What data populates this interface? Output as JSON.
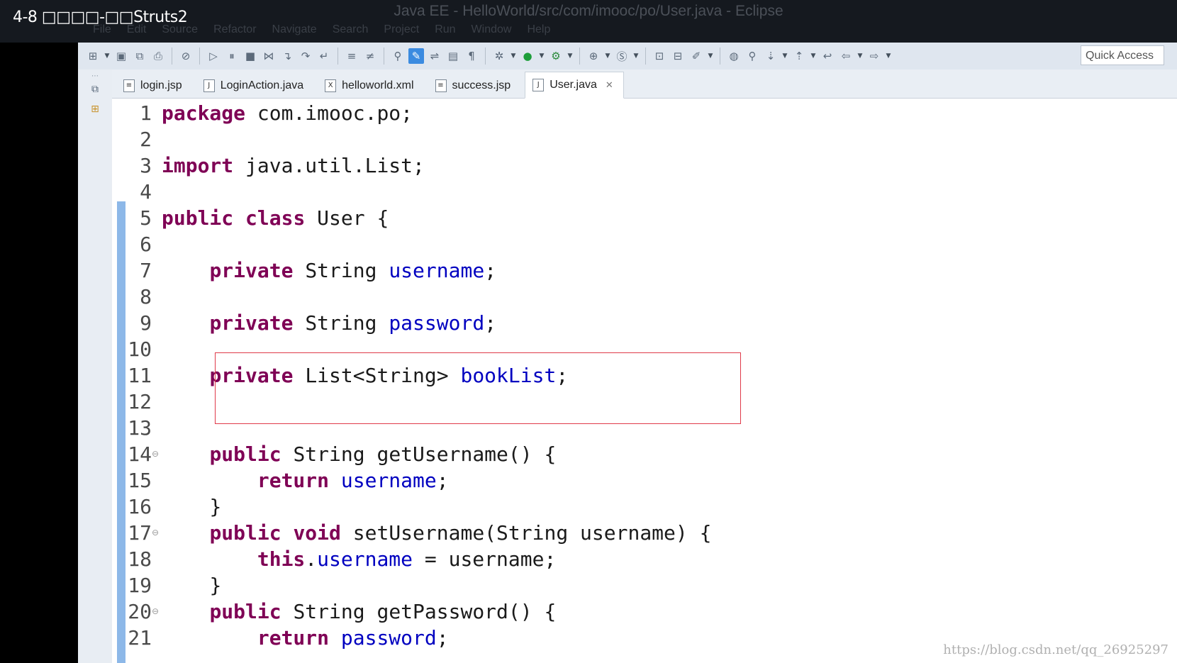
{
  "video_title": "4-8 □□□□-□□Struts2",
  "window": {
    "title": "Java EE - HelloWorld/src/com/imooc/po/User.java - Eclipse",
    "menus": [
      "File",
      "Edit",
      "Source",
      "Refactor",
      "Navigate",
      "Search",
      "Project",
      "Run",
      "Window",
      "Help"
    ]
  },
  "toolbar": {
    "quick_access": "Quick Access"
  },
  "tabs": [
    {
      "label": "login.jsp",
      "icon": "jsp-file-icon",
      "glyph": "≡"
    },
    {
      "label": "LoginAction.java",
      "icon": "java-file-icon",
      "glyph": "J"
    },
    {
      "label": "helloworld.xml",
      "icon": "xml-file-icon",
      "glyph": "X"
    },
    {
      "label": "success.jsp",
      "icon": "jsp-file-icon",
      "glyph": "≡"
    },
    {
      "label": "User.java",
      "icon": "java-file-icon",
      "glyph": "J",
      "active": true
    }
  ],
  "code_lines": [
    {
      "n": "1",
      "tokens": [
        [
          "kw",
          "package"
        ],
        [
          "",
          "com.imooc.po;"
        ]
      ]
    },
    {
      "n": "2",
      "tokens": []
    },
    {
      "n": "3",
      "tokens": [
        [
          "kw",
          "import"
        ],
        [
          "",
          "java.util.List;"
        ]
      ]
    },
    {
      "n": "4",
      "tokens": []
    },
    {
      "n": "5",
      "tokens": [
        [
          "kw",
          "public"
        ],
        [
          "kw",
          "class"
        ],
        [
          "",
          "User {"
        ]
      ]
    },
    {
      "n": "6",
      "tokens": []
    },
    {
      "n": "7",
      "indent": 1,
      "tokens": [
        [
          "kw",
          "private"
        ],
        [
          "",
          "String"
        ],
        [
          "fld",
          "username"
        ],
        [
          "",
          ";"
        ]
      ]
    },
    {
      "n": "8",
      "tokens": []
    },
    {
      "n": "9",
      "indent": 1,
      "tokens": [
        [
          "kw",
          "private"
        ],
        [
          "",
          "String"
        ],
        [
          "fld",
          "password"
        ],
        [
          "",
          ";"
        ]
      ]
    },
    {
      "n": "10",
      "tokens": []
    },
    {
      "n": "11",
      "indent": 1,
      "tokens": [
        [
          "kw",
          "private"
        ],
        [
          "",
          "List<String>"
        ],
        [
          "fld",
          "bookList"
        ],
        [
          "",
          ";"
        ]
      ]
    },
    {
      "n": "12",
      "tokens": []
    },
    {
      "n": "13",
      "tokens": []
    },
    {
      "n": "14",
      "fold": true,
      "indent": 1,
      "tokens": [
        [
          "kw",
          "public"
        ],
        [
          "",
          "String getUsername() {"
        ]
      ]
    },
    {
      "n": "15",
      "indent": 2,
      "tokens": [
        [
          "kw",
          "return"
        ],
        [
          "fld",
          "username"
        ],
        [
          "",
          ";"
        ]
      ]
    },
    {
      "n": "16",
      "indent": 1,
      "tokens": [
        [
          "",
          "}"
        ]
      ]
    },
    {
      "n": "17",
      "fold": true,
      "indent": 1,
      "tokens": [
        [
          "kw",
          "public"
        ],
        [
          "kw",
          "void"
        ],
        [
          "",
          "setUsername(String username) {"
        ]
      ]
    },
    {
      "n": "18",
      "indent": 2,
      "tokens": [
        [
          "kw",
          "this"
        ],
        [
          "",
          ".~"
        ],
        [
          "fld",
          "username"
        ],
        [
          "",
          " = username;"
        ]
      ]
    },
    {
      "n": "19",
      "indent": 1,
      "tokens": [
        [
          "",
          "}"
        ]
      ]
    },
    {
      "n": "20",
      "fold": true,
      "indent": 1,
      "tokens": [
        [
          "kw",
          "public"
        ],
        [
          "",
          "String getPassword() {"
        ]
      ]
    },
    {
      "n": "21",
      "indent": 2,
      "tokens": [
        [
          "kw",
          "return"
        ],
        [
          "fld",
          "password"
        ],
        [
          "",
          ";"
        ]
      ]
    }
  ],
  "watermark": "https://blog.csdn.net/qq_26925297"
}
